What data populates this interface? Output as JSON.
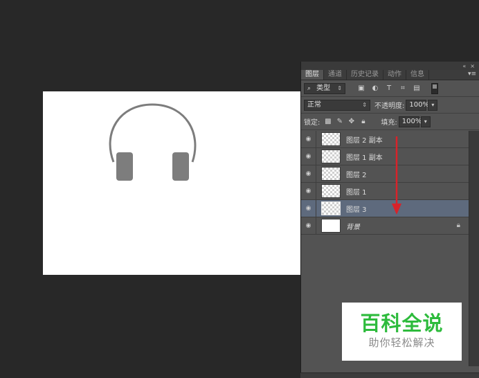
{
  "panel": {
    "tabs": [
      {
        "label": "图层",
        "active": true
      },
      {
        "label": "通道",
        "active": false
      },
      {
        "label": "历史记录",
        "active": false
      },
      {
        "label": "动作",
        "active": false
      },
      {
        "label": "信息",
        "active": false
      }
    ],
    "topbar_icons": [
      "collapse-icon",
      "close-icon"
    ],
    "menu_icon": "panel-menu-icon",
    "filter": {
      "kind_label": "类型",
      "icons": [
        "pixel-filter-icon",
        "adjustment-filter-icon",
        "type-filter-icon",
        "shape-filter-icon",
        "smart-object-filter-icon"
      ]
    },
    "blend_mode": "正常",
    "opacity_label": "不透明度:",
    "opacity_value": "100%",
    "lock_label": "锁定:",
    "lock_icons": [
      "lock-transparent-icon",
      "lock-paint-icon",
      "lock-move-icon",
      "lock-all-icon"
    ],
    "fill_label": "填充:",
    "fill_value": "100%"
  },
  "layers": [
    {
      "name": "图层 2 副本",
      "selected": false,
      "thumb": "transparent"
    },
    {
      "name": "图层 1 副本",
      "selected": false,
      "thumb": "transparent"
    },
    {
      "name": "图层 2",
      "selected": false,
      "thumb": "transparent"
    },
    {
      "name": "图层 1",
      "selected": false,
      "thumb": "transparent"
    },
    {
      "name": "图层 3",
      "selected": true,
      "thumb": "transparent"
    },
    {
      "name": "背景",
      "selected": false,
      "thumb": "white",
      "locked": true
    }
  ],
  "watermark": {
    "title": "百科全说",
    "subtitle": "助你轻松解决"
  },
  "colors": {
    "workspace": "#282828",
    "panel": "#535353",
    "selected_layer": "#5e6a7d",
    "headphone_gray": "#7d7d7d",
    "annotation_arrow": "#d8232a",
    "watermark_green": "#2dbb3c"
  }
}
